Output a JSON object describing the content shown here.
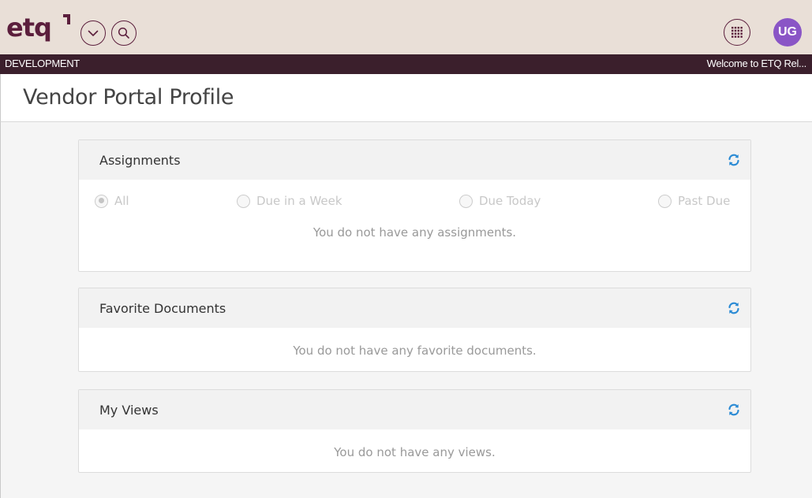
{
  "brand": {
    "logo_text": "etq",
    "accent": "#5b1e3c",
    "topbar_bg": "#e9dfd7",
    "subbar_bg": "#3b1f2c"
  },
  "topbar": {
    "avatar_initials": "UG",
    "avatar_color": "#8a55c6",
    "icons": [
      "chevron-down-icon",
      "search-icon",
      "app-grid-icon"
    ]
  },
  "subbar": {
    "environment": "DEVELOPMENT",
    "welcome": "Welcome to ETQ Rel..."
  },
  "page": {
    "title": "Vendor Portal Profile"
  },
  "assignments": {
    "title": "Assignments",
    "filters": [
      "All",
      "Due in a Week",
      "Due Today",
      "Past Due"
    ],
    "selected_filter": "All",
    "empty_text": "You do not have any assignments."
  },
  "favorites": {
    "title": "Favorite Documents",
    "empty_text": "You do not have any favorite documents."
  },
  "views": {
    "title": "My Views",
    "empty_text": "You do not have any views."
  },
  "refresh_color": "#2a8ad4"
}
